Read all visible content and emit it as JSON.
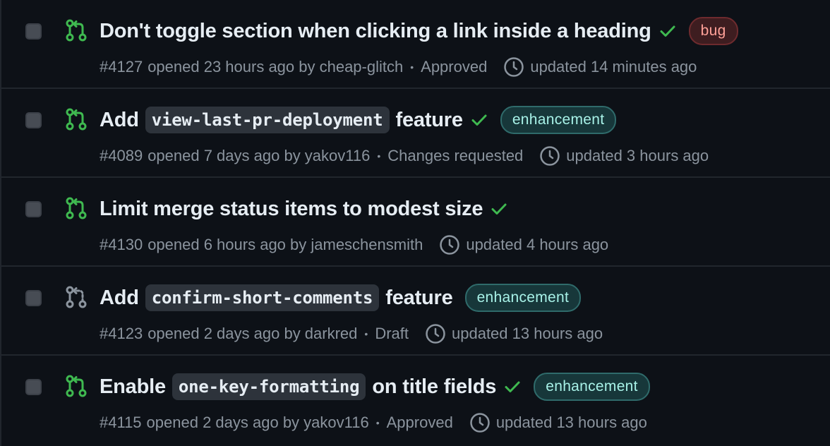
{
  "colors": {
    "background": "#0d1117",
    "open_icon": "#3fb950",
    "draft_icon": "#8b949e",
    "check": "#3fb950",
    "bug_label": "#ffa198",
    "enhancement_label": "#a8f2e8"
  },
  "pull_requests": [
    {
      "title_parts": [
        "Don't toggle section when clicking a link inside a heading"
      ],
      "state_icon": "git-pull-request-icon",
      "status_check": "check-icon",
      "label": "bug",
      "number": "#4127",
      "opened": "opened 23 hours ago by cheap-glitch",
      "review": "Approved",
      "updated": "updated 14 minutes ago"
    },
    {
      "title_parts": [
        "Add",
        "view-last-pr-deployment",
        "feature"
      ],
      "state_icon": "git-pull-request-icon",
      "status_check": "check-icon",
      "label": "enhancement",
      "number": "#4089",
      "opened": "opened 7 days ago by yakov116",
      "review": "Changes requested",
      "updated": "updated 3 hours ago"
    },
    {
      "title_parts": [
        "Limit merge status items to modest size"
      ],
      "state_icon": "git-pull-request-icon",
      "status_check": "check-icon",
      "label": "",
      "number": "#4130",
      "opened": "opened 6 hours ago by jameschensmith",
      "review": "",
      "updated": "updated 4 hours ago"
    },
    {
      "title_parts": [
        "Add",
        "confirm-short-comments",
        "feature"
      ],
      "state_icon": "git-pull-request-draft-icon",
      "status_check": "",
      "label": "enhancement",
      "number": "#4123",
      "opened": "opened 2 days ago by darkred",
      "review": "Draft",
      "updated": "updated 13 hours ago"
    },
    {
      "title_parts": [
        "Enable",
        "one-key-formatting",
        "on title fields"
      ],
      "state_icon": "git-pull-request-icon",
      "status_check": "check-icon",
      "label": "enhancement",
      "number": "#4115",
      "opened": "opened 2 days ago by yakov116",
      "review": "Approved",
      "updated": "updated 13 hours ago"
    }
  ]
}
